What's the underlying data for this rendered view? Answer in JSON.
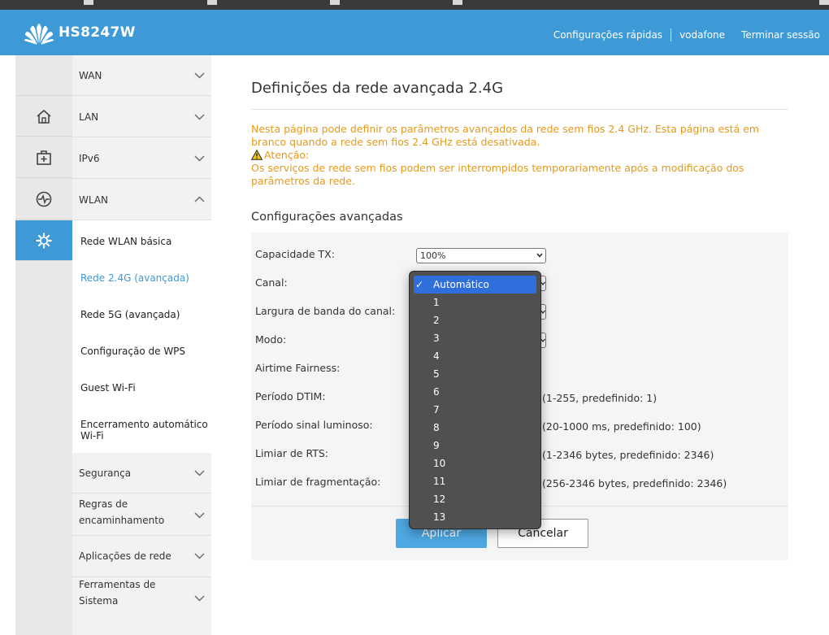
{
  "header": {
    "brand": "HS8247W",
    "links": [
      "Configurações rápidas",
      "vodafone",
      "Terminar sessão"
    ]
  },
  "rail": {
    "items": [
      {
        "icon": "home-icon"
      },
      {
        "icon": "first-aid-kit-icon"
      },
      {
        "icon": "pulse-monitor-icon"
      },
      {
        "icon": "gear-icon",
        "active": true
      }
    ]
  },
  "menu": {
    "wan": "WAN",
    "lan": "LAN",
    "ipv6": "IPv6",
    "wlan": "WLAN",
    "wlan_items": [
      "Rede WLAN básica",
      "Rede 2.4G (avançada)",
      "Rede 5G (avançada)",
      "Configuração de WPS",
      "Guest Wi-Fi",
      "Encerramento automático",
      "Wi-Fi"
    ],
    "seguranca": "Segurança",
    "regras_1": "Regras de",
    "regras_2": "encaminhamento",
    "aplicacoes": "Aplicações de rede",
    "ferramentas_1": "Ferramentas de",
    "ferramentas_2": "Sistema"
  },
  "page": {
    "title": "Definições da rede avançada 2.4G",
    "info_line1": "Nesta página pode definir os parâmetros avançados da rede sem fios 2.4 GHz. Esta página está em",
    "info_line2": "branco quando a rede sem fios 2.4 GHz está desativada.",
    "attention": "Atenção:",
    "warn_line1": "Os serviços de rede sem fios podem ser interrompidos temporariamente após a modificação dos",
    "warn_line2": "parâmetros da rede.",
    "section_title": "Configurações avançadas"
  },
  "form": {
    "tx_label": "Capacidade TX:",
    "tx_value": "100%",
    "canal_label": "Canal:",
    "largura_label": "Largura de banda do canal:",
    "modo_label": "Modo:",
    "airtime_label": "Airtime Fairness:",
    "dtim_label": "Período DTIM:",
    "dtim_hint": "(1-255, predefinido: 1)",
    "beacon_label": "Período sinal luminoso:",
    "beacon_hint": "(20-1000 ms, predefinido: 100)",
    "rts_label": "Limiar de RTS:",
    "rts_hint": "(1-2346 bytes, predefinido: 2346)",
    "frag_label": "Limiar de fragmentação:",
    "frag_hint": "(256-2346 bytes, predefinido: 2346)",
    "apply": "Aplicar",
    "cancel": "Cancelar"
  },
  "canal_dropdown": {
    "selected": "Automático",
    "options": [
      "Automático",
      "1",
      "2",
      "3",
      "4",
      "5",
      "6",
      "7",
      "8",
      "9",
      "10",
      "11",
      "12",
      "13"
    ]
  },
  "colors": {
    "accent": "#3d9ad6",
    "warning": "#e49a1c",
    "dropdown_bg": "#505050",
    "dropdown_selected": "#2f6fdc"
  }
}
